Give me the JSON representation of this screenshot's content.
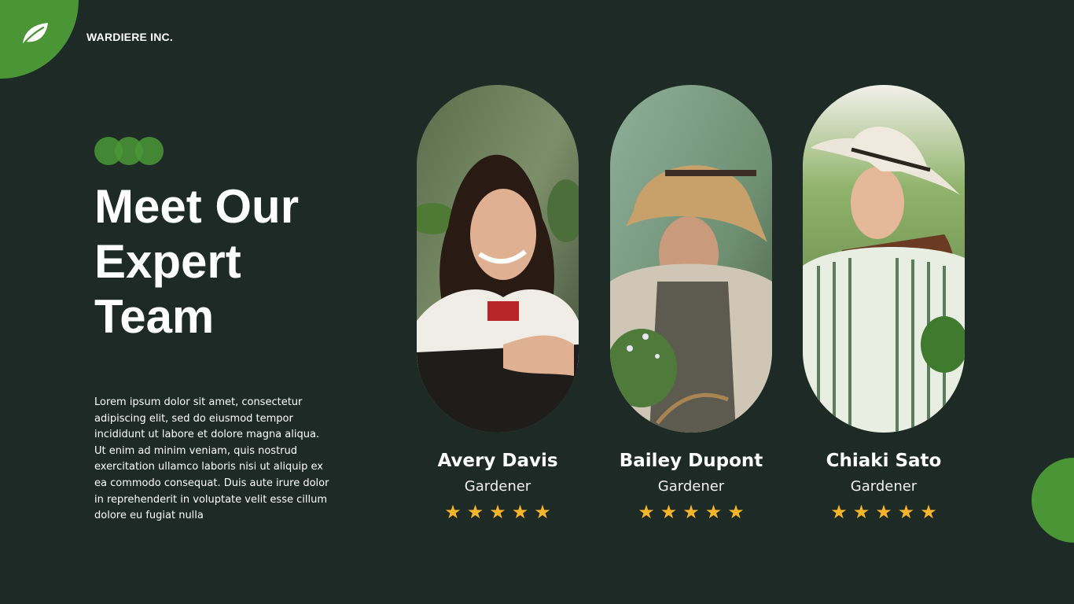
{
  "brand": {
    "name": "WARDIERE INC.",
    "logo_icon": "leaf-icon"
  },
  "colors": {
    "background": "#1e2a25",
    "accent": "#4a9636",
    "star": "#f7b52b"
  },
  "hero": {
    "title_lines": [
      "Meet Our",
      "Expert",
      "Team"
    ],
    "description": "Lorem ipsum dolor sit amet, consectetur adipiscing elit, sed do eiusmod tempor incididunt ut labore et dolore magna aliqua. Ut enim ad minim veniam, quis nostrud exercitation ullamco laboris nisi ut aliquip ex ea commodo consequat. Duis aute irure dolor in reprehenderit in voluptate velit esse cillum dolore eu fugiat nulla"
  },
  "team": [
    {
      "name": "Avery Davis",
      "role": "Gardener",
      "rating": 5
    },
    {
      "name": "Bailey Dupont",
      "role": "Gardener",
      "rating": 5
    },
    {
      "name": "Chiaki Sato",
      "role": "Gardener",
      "rating": 5
    }
  ],
  "star_icon": "★"
}
